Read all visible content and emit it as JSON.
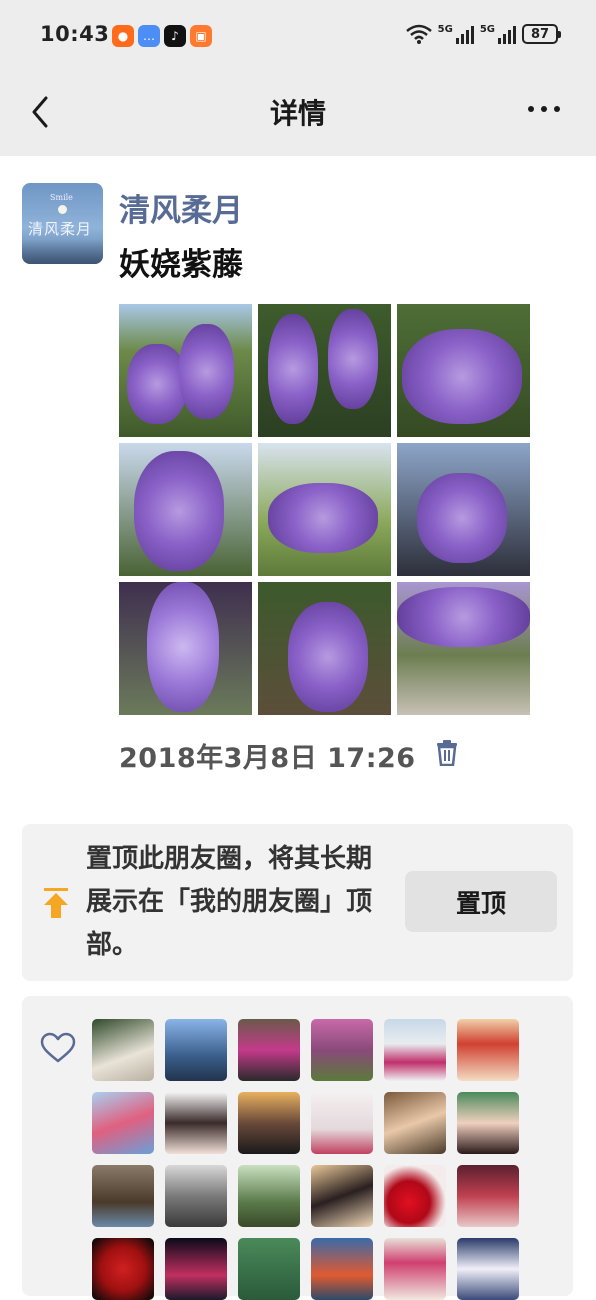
{
  "status_bar": {
    "time": "10:43",
    "network_1": "5G",
    "network_2": "5G",
    "battery": "87",
    "app_icons": [
      "news-app-icon",
      "chat-bubble-app-icon",
      "tiktok-app-icon",
      "shop-app-icon"
    ]
  },
  "nav": {
    "title": "详情",
    "back_icon": "chevron-left-icon",
    "more_icon": "more-dots-icon"
  },
  "post": {
    "username": "清风柔月",
    "text": "妖娆紫藤",
    "avatar_text": "清风柔月",
    "avatar_small_text": "Smile",
    "photo_count": 9,
    "timestamp": "2018年3月8日 17:26",
    "delete_icon": "trash-icon"
  },
  "pin": {
    "text": "置顶此朋友圈，将其长期展示在「我的朋友圈」顶部。",
    "button": "置顶",
    "icon": "pin-top-icon"
  },
  "likes": {
    "icon": "heart-outline-icon",
    "avatar_count": 24
  },
  "colors": {
    "link_blue": "#576b95",
    "page_bg": "#ededed",
    "card_bg": "#f2f2f2",
    "pin_orange": "#f5a623"
  }
}
